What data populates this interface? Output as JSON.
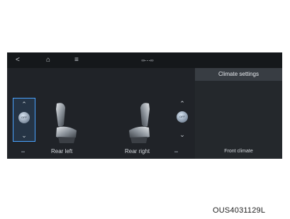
{
  "topbar": {
    "back_icon": "back-icon",
    "home_icon": "home-icon",
    "menu_icon": "menu-icon",
    "connection_icon": "connection-icon"
  },
  "seats": {
    "rear_left": {
      "label": "Rear left",
      "heat_level": "OFF"
    },
    "rear_right": {
      "label": "Rear right",
      "heat_level": "OFF"
    }
  },
  "side_panel": {
    "title": "Climate settings",
    "footer_label": "Front climate"
  },
  "caption": "OUS4031129L",
  "colors": {
    "accent": "#4aa3ff",
    "screen_bg": "#1d2024"
  }
}
